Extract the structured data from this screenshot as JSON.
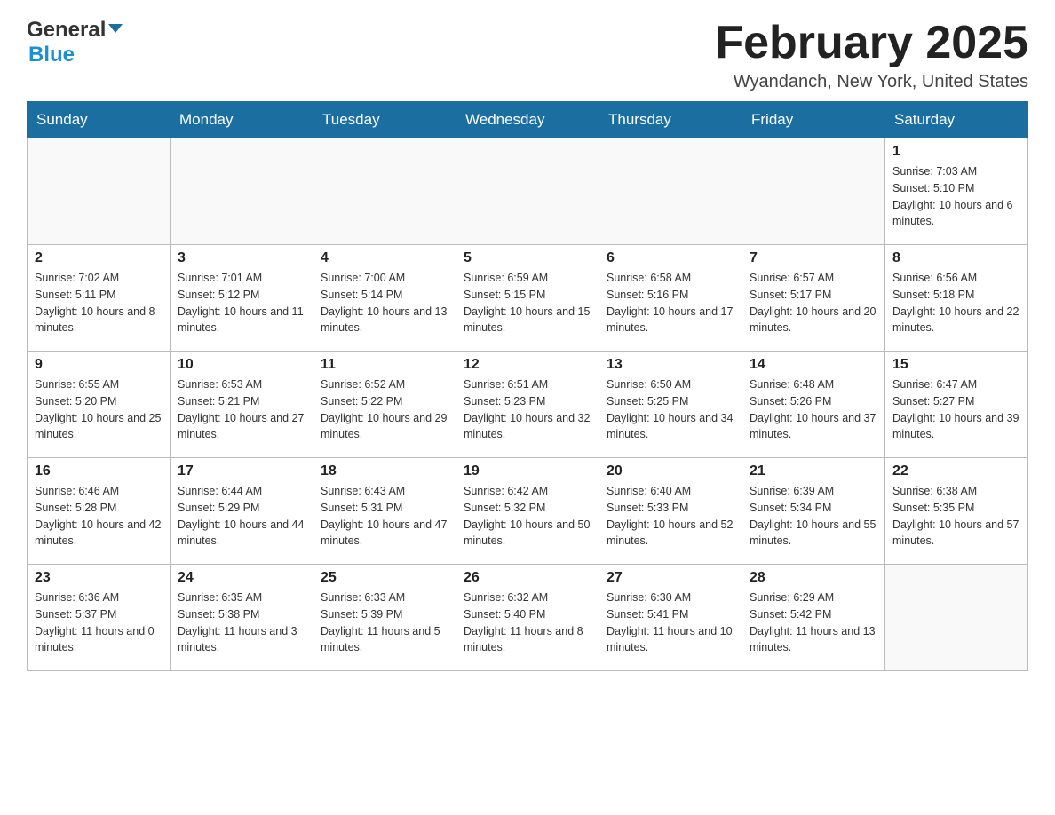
{
  "header": {
    "logo": {
      "general": "General",
      "blue": "Blue"
    },
    "title": "February 2025",
    "location": "Wyandanch, New York, United States"
  },
  "days_of_week": [
    "Sunday",
    "Monday",
    "Tuesday",
    "Wednesday",
    "Thursday",
    "Friday",
    "Saturday"
  ],
  "weeks": [
    [
      {
        "day": "",
        "info": ""
      },
      {
        "day": "",
        "info": ""
      },
      {
        "day": "",
        "info": ""
      },
      {
        "day": "",
        "info": ""
      },
      {
        "day": "",
        "info": ""
      },
      {
        "day": "",
        "info": ""
      },
      {
        "day": "1",
        "info": "Sunrise: 7:03 AM\nSunset: 5:10 PM\nDaylight: 10 hours and 6 minutes."
      }
    ],
    [
      {
        "day": "2",
        "info": "Sunrise: 7:02 AM\nSunset: 5:11 PM\nDaylight: 10 hours and 8 minutes."
      },
      {
        "day": "3",
        "info": "Sunrise: 7:01 AM\nSunset: 5:12 PM\nDaylight: 10 hours and 11 minutes."
      },
      {
        "day": "4",
        "info": "Sunrise: 7:00 AM\nSunset: 5:14 PM\nDaylight: 10 hours and 13 minutes."
      },
      {
        "day": "5",
        "info": "Sunrise: 6:59 AM\nSunset: 5:15 PM\nDaylight: 10 hours and 15 minutes."
      },
      {
        "day": "6",
        "info": "Sunrise: 6:58 AM\nSunset: 5:16 PM\nDaylight: 10 hours and 17 minutes."
      },
      {
        "day": "7",
        "info": "Sunrise: 6:57 AM\nSunset: 5:17 PM\nDaylight: 10 hours and 20 minutes."
      },
      {
        "day": "8",
        "info": "Sunrise: 6:56 AM\nSunset: 5:18 PM\nDaylight: 10 hours and 22 minutes."
      }
    ],
    [
      {
        "day": "9",
        "info": "Sunrise: 6:55 AM\nSunset: 5:20 PM\nDaylight: 10 hours and 25 minutes."
      },
      {
        "day": "10",
        "info": "Sunrise: 6:53 AM\nSunset: 5:21 PM\nDaylight: 10 hours and 27 minutes."
      },
      {
        "day": "11",
        "info": "Sunrise: 6:52 AM\nSunset: 5:22 PM\nDaylight: 10 hours and 29 minutes."
      },
      {
        "day": "12",
        "info": "Sunrise: 6:51 AM\nSunset: 5:23 PM\nDaylight: 10 hours and 32 minutes."
      },
      {
        "day": "13",
        "info": "Sunrise: 6:50 AM\nSunset: 5:25 PM\nDaylight: 10 hours and 34 minutes."
      },
      {
        "day": "14",
        "info": "Sunrise: 6:48 AM\nSunset: 5:26 PM\nDaylight: 10 hours and 37 minutes."
      },
      {
        "day": "15",
        "info": "Sunrise: 6:47 AM\nSunset: 5:27 PM\nDaylight: 10 hours and 39 minutes."
      }
    ],
    [
      {
        "day": "16",
        "info": "Sunrise: 6:46 AM\nSunset: 5:28 PM\nDaylight: 10 hours and 42 minutes."
      },
      {
        "day": "17",
        "info": "Sunrise: 6:44 AM\nSunset: 5:29 PM\nDaylight: 10 hours and 44 minutes."
      },
      {
        "day": "18",
        "info": "Sunrise: 6:43 AM\nSunset: 5:31 PM\nDaylight: 10 hours and 47 minutes."
      },
      {
        "day": "19",
        "info": "Sunrise: 6:42 AM\nSunset: 5:32 PM\nDaylight: 10 hours and 50 minutes."
      },
      {
        "day": "20",
        "info": "Sunrise: 6:40 AM\nSunset: 5:33 PM\nDaylight: 10 hours and 52 minutes."
      },
      {
        "day": "21",
        "info": "Sunrise: 6:39 AM\nSunset: 5:34 PM\nDaylight: 10 hours and 55 minutes."
      },
      {
        "day": "22",
        "info": "Sunrise: 6:38 AM\nSunset: 5:35 PM\nDaylight: 10 hours and 57 minutes."
      }
    ],
    [
      {
        "day": "23",
        "info": "Sunrise: 6:36 AM\nSunset: 5:37 PM\nDaylight: 11 hours and 0 minutes."
      },
      {
        "day": "24",
        "info": "Sunrise: 6:35 AM\nSunset: 5:38 PM\nDaylight: 11 hours and 3 minutes."
      },
      {
        "day": "25",
        "info": "Sunrise: 6:33 AM\nSunset: 5:39 PM\nDaylight: 11 hours and 5 minutes."
      },
      {
        "day": "26",
        "info": "Sunrise: 6:32 AM\nSunset: 5:40 PM\nDaylight: 11 hours and 8 minutes."
      },
      {
        "day": "27",
        "info": "Sunrise: 6:30 AM\nSunset: 5:41 PM\nDaylight: 11 hours and 10 minutes."
      },
      {
        "day": "28",
        "info": "Sunrise: 6:29 AM\nSunset: 5:42 PM\nDaylight: 11 hours and 13 minutes."
      },
      {
        "day": "",
        "info": ""
      }
    ]
  ],
  "colors": {
    "header_bg": "#1a6fa0",
    "header_text": "#ffffff",
    "accent_blue": "#1a8fd1"
  }
}
